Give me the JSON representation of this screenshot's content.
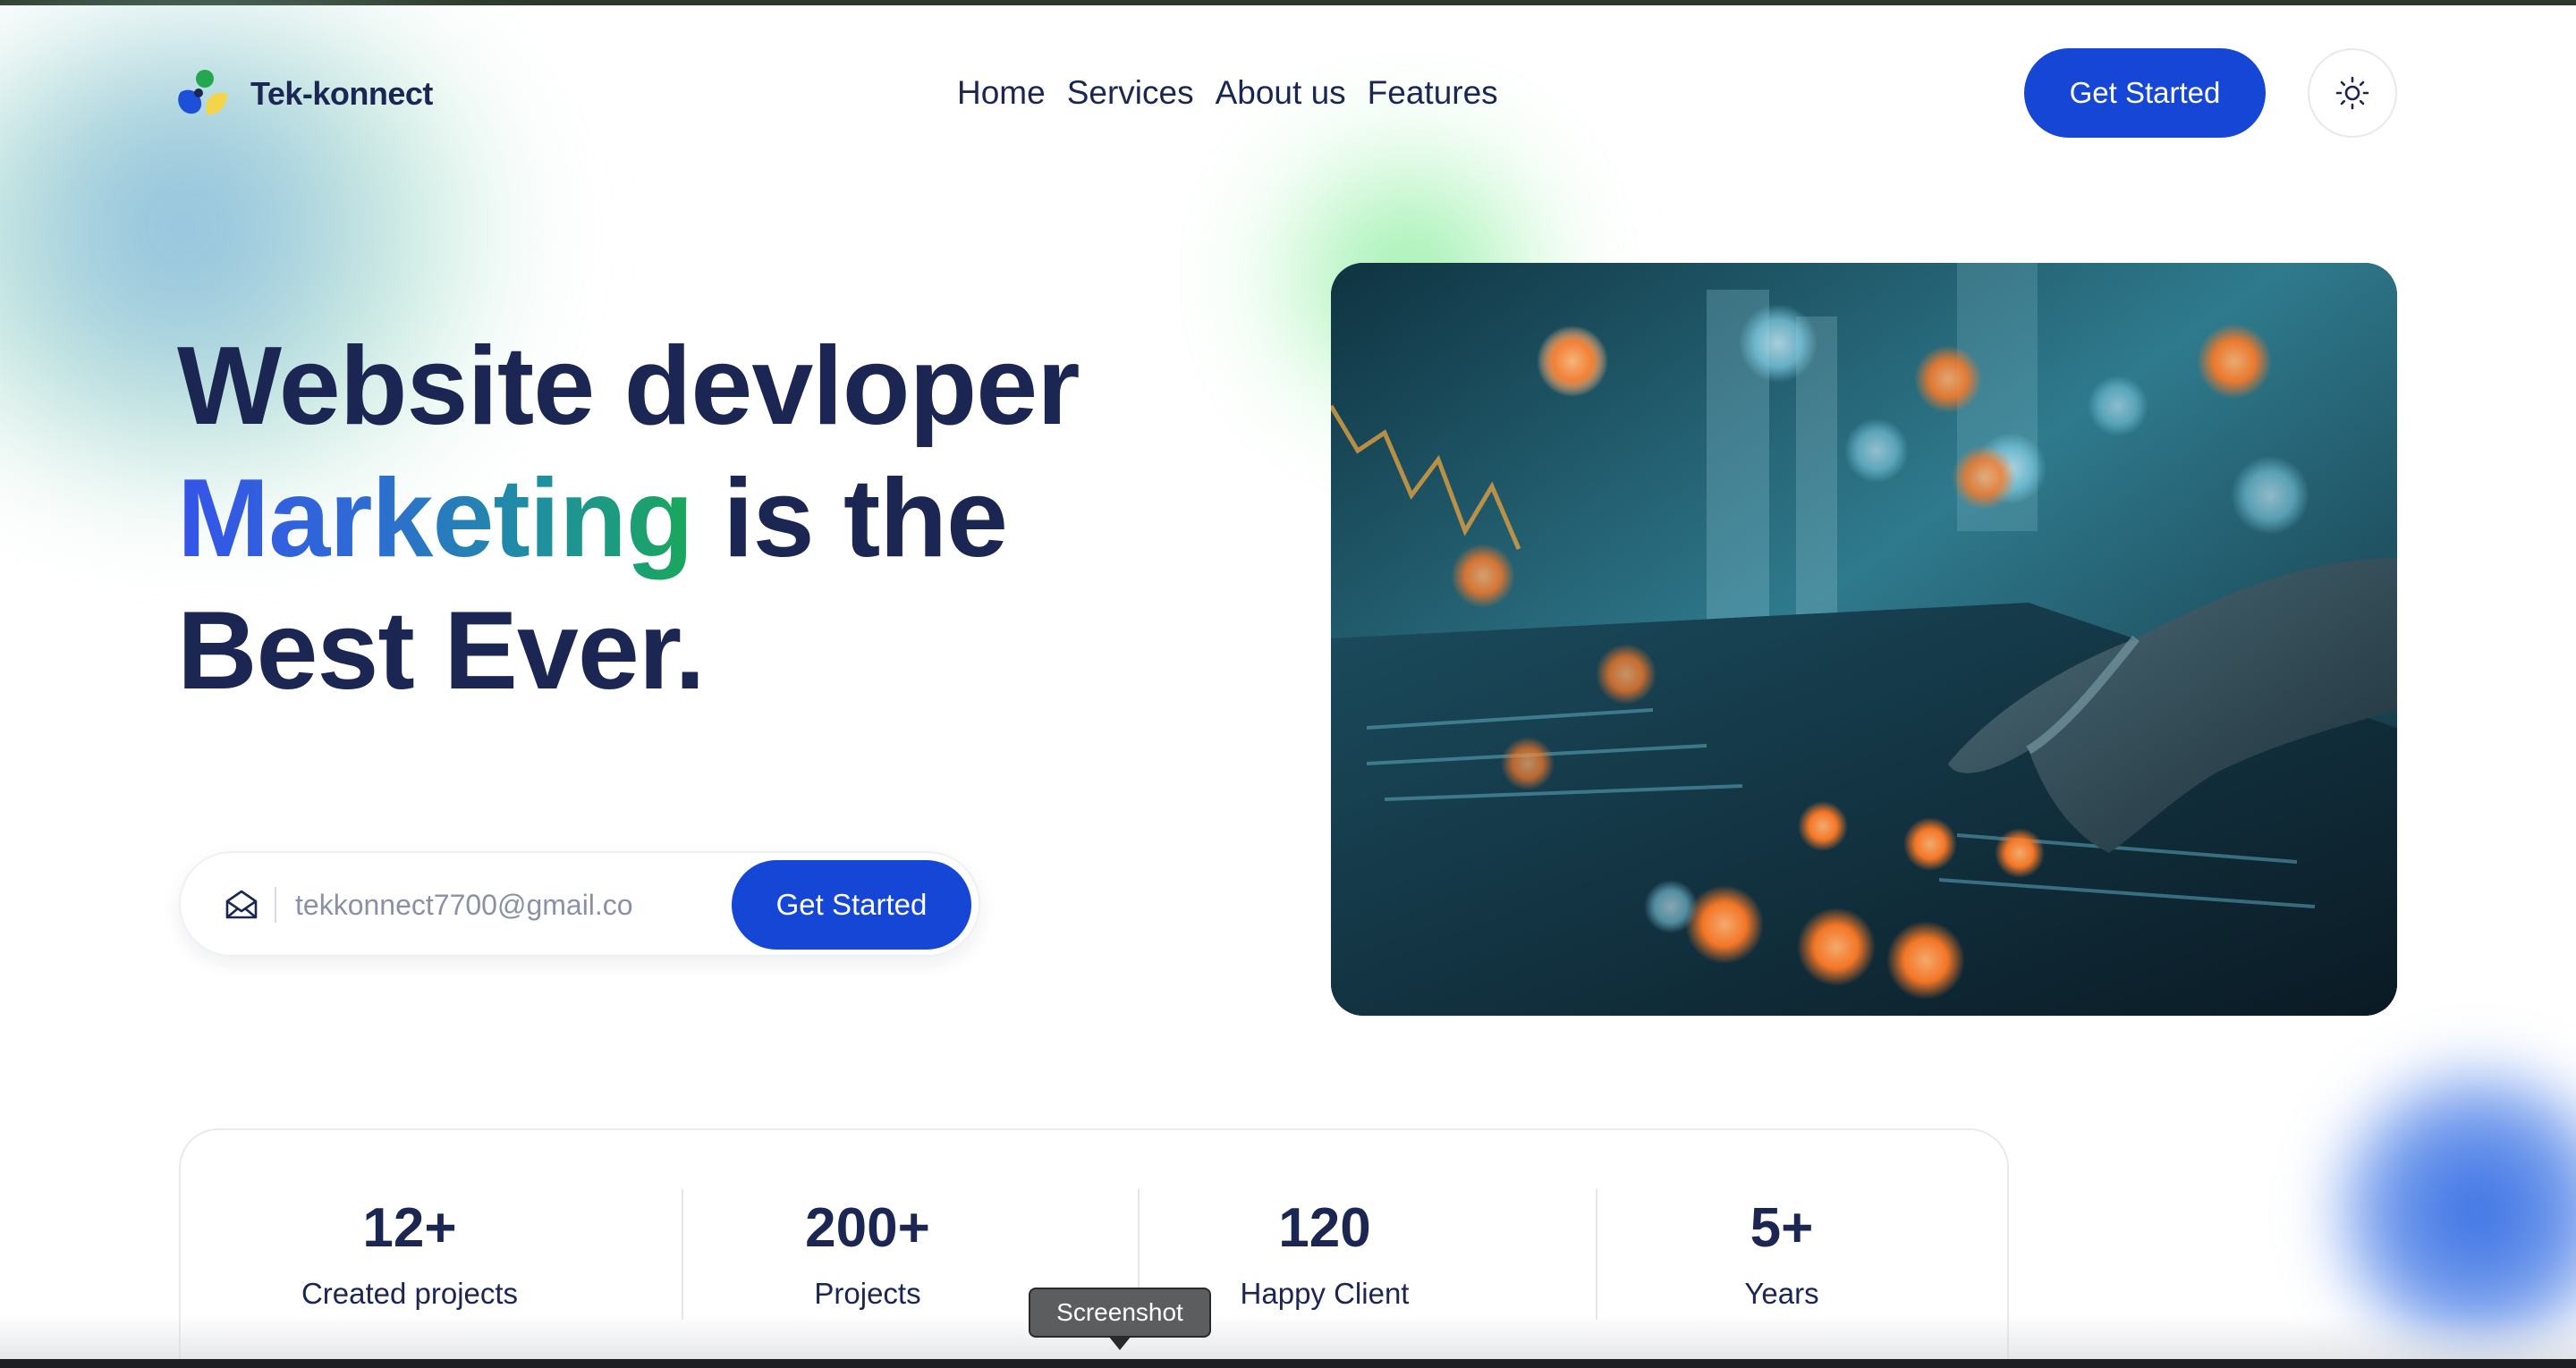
{
  "brand": {
    "name": "Tek-konnect"
  },
  "nav": {
    "items": [
      "Home",
      "Services",
      "About us",
      "Features"
    ]
  },
  "header": {
    "cta_label": "Get Started",
    "theme_toggle_icon": "sun-icon"
  },
  "hero": {
    "line1": "Website devloper",
    "line2_accent": "Marketing",
    "line2_rest": " is the",
    "line3": "Best Ever.",
    "email_value": "",
    "email_placeholder": "tekkonnect7700@gmail.co",
    "email_icon": "mail-open-icon",
    "cta_label": "Get Started",
    "image_subject": "hand-typing-on-laptop-with-bokeh-lights"
  },
  "stats": [
    {
      "value": "12+",
      "label": "Created projects"
    },
    {
      "value": "200+",
      "label": "Projects"
    },
    {
      "value": "120",
      "label": "Happy Client"
    },
    {
      "value": "5+",
      "label": "Years"
    }
  ],
  "tooltip": {
    "label": "Screenshot"
  },
  "colors": {
    "primary": "#1546d6",
    "text": "#1b2653",
    "accent_gradient": [
      "#3554e8",
      "#1aa85a"
    ]
  }
}
